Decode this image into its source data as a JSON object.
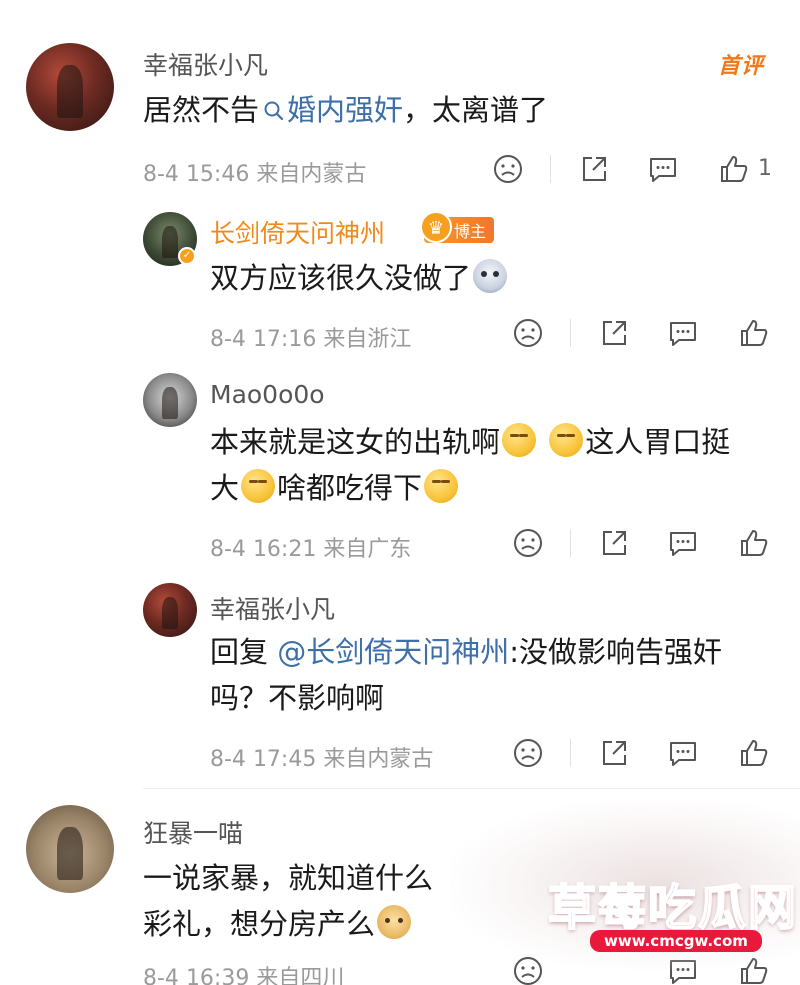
{
  "comments": [
    {
      "username": "幸福张小凡",
      "badge": "首评",
      "text_prefix": "居然不告",
      "search_tag": "婚内强奸",
      "text_suffix": "，太离谱了",
      "date": "8-4",
      "time": "15:46",
      "location": "来自内蒙古",
      "likes": "1"
    }
  ],
  "replies": [
    {
      "username": "长剑倚天问神州",
      "badge": "博主",
      "text": "双方应该很久没做了",
      "date": "8-4",
      "time": "17:16",
      "location": "来自浙江"
    },
    {
      "username": "Mao0o0o",
      "text_line1_a": "本来就是这女的出轨啊",
      "text_line1_b": "这人胃口挺",
      "text_line2_a": "大",
      "text_line2_b": "啥都吃得下",
      "date": "8-4",
      "time": "16:21",
      "location": "来自广东"
    },
    {
      "username": "幸福张小凡",
      "reply_prefix": "回复",
      "mention": "@长剑倚天问神州",
      "text_line1": ":没做影响告强奸",
      "text_line2": "吗？不影响啊",
      "date": "8-4",
      "time": "17:45",
      "location": "来自内蒙古"
    }
  ],
  "second_comment": {
    "username": "狂暴一喵",
    "text_line1": "一说家暴，就知道什么",
    "text_line2": "彩礼，想分房产么",
    "date": "8-4",
    "time": "16:39",
    "location": "来自四川"
  },
  "watermark": {
    "title": "草莓吃瓜网",
    "url": "www.cmcgw.com"
  },
  "colors": {
    "username_orange": "#f08a1c",
    "link_blue": "#3e6fa8",
    "meta_gray": "#9a9a9a",
    "watermark_red": "#e8193a"
  },
  "icons": [
    "dislike-face-icon",
    "share-icon",
    "comment-icon",
    "like-thumb-icon",
    "search-icon",
    "crown-icon",
    "verified-icon"
  ]
}
